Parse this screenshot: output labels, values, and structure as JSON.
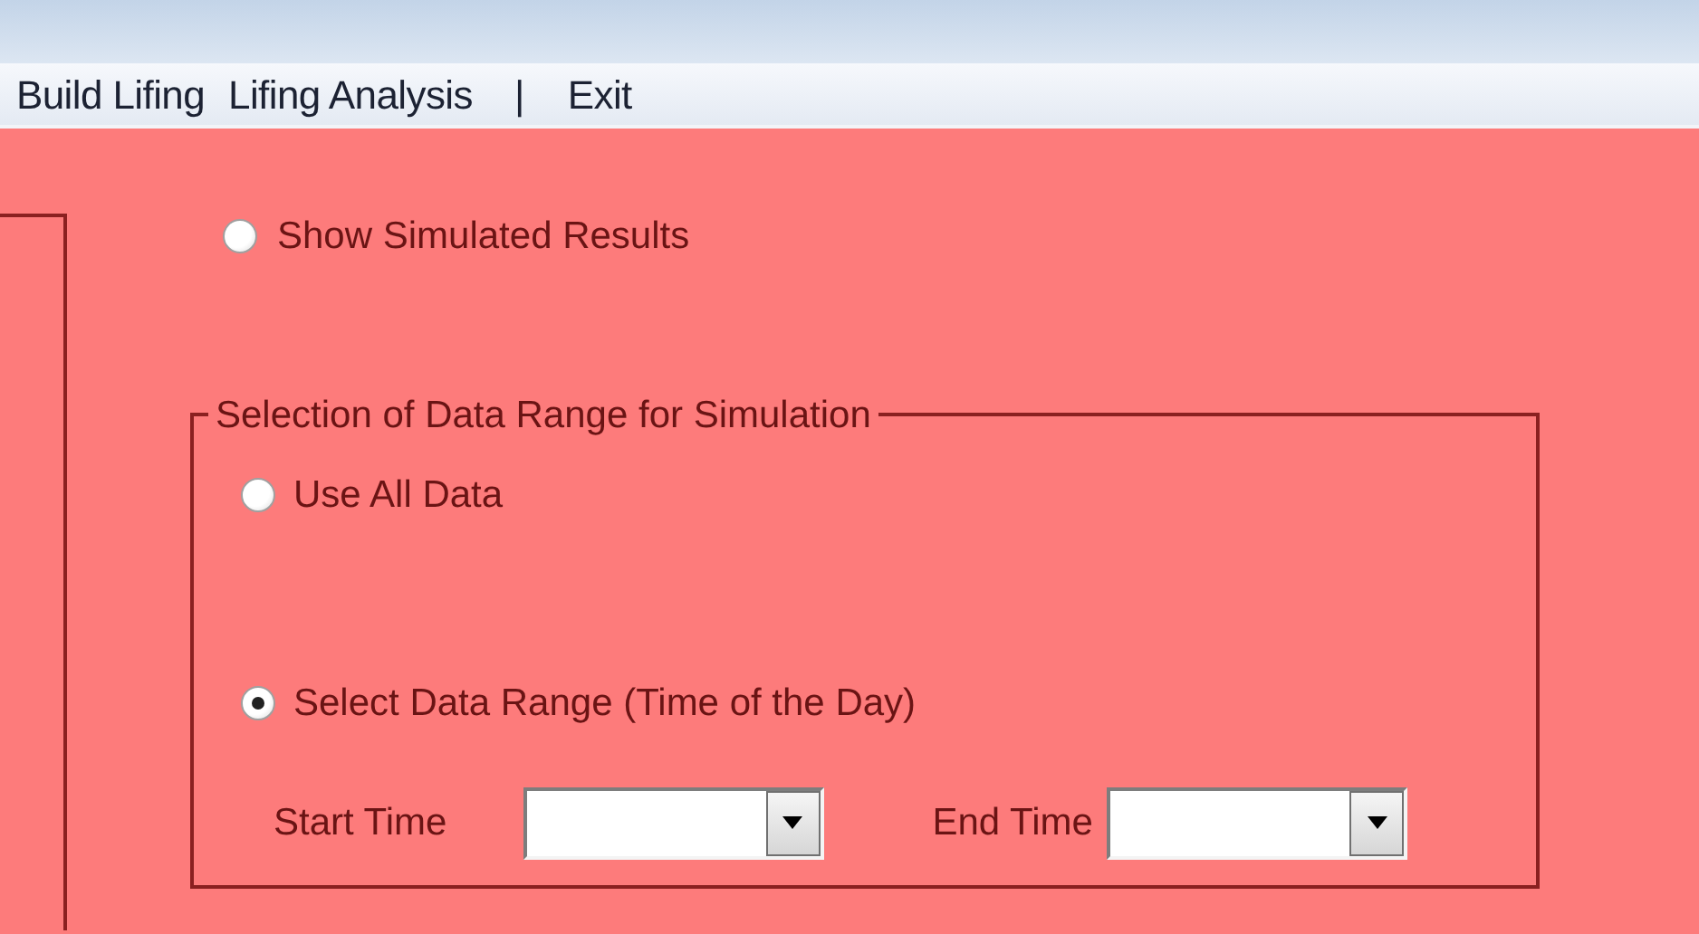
{
  "menu": [
    {
      "label": "Build Lifing",
      "kind": "item"
    },
    {
      "label": "Lifing Analysis",
      "kind": "item"
    },
    {
      "label": "|",
      "kind": "separator"
    },
    {
      "label": "Exit",
      "kind": "item"
    }
  ],
  "show_results": {
    "label": "Show Simulated Results",
    "selected": false
  },
  "data_range": {
    "title": "Selection of Data Range for Simulation",
    "options": [
      {
        "label": "Use All Data",
        "selected": false
      },
      {
        "label": "Select Data Range (Time of the Day)",
        "selected": true
      }
    ],
    "start_time": {
      "label": "Start Time"
    },
    "end_time": {
      "label": "End Time"
    }
  }
}
